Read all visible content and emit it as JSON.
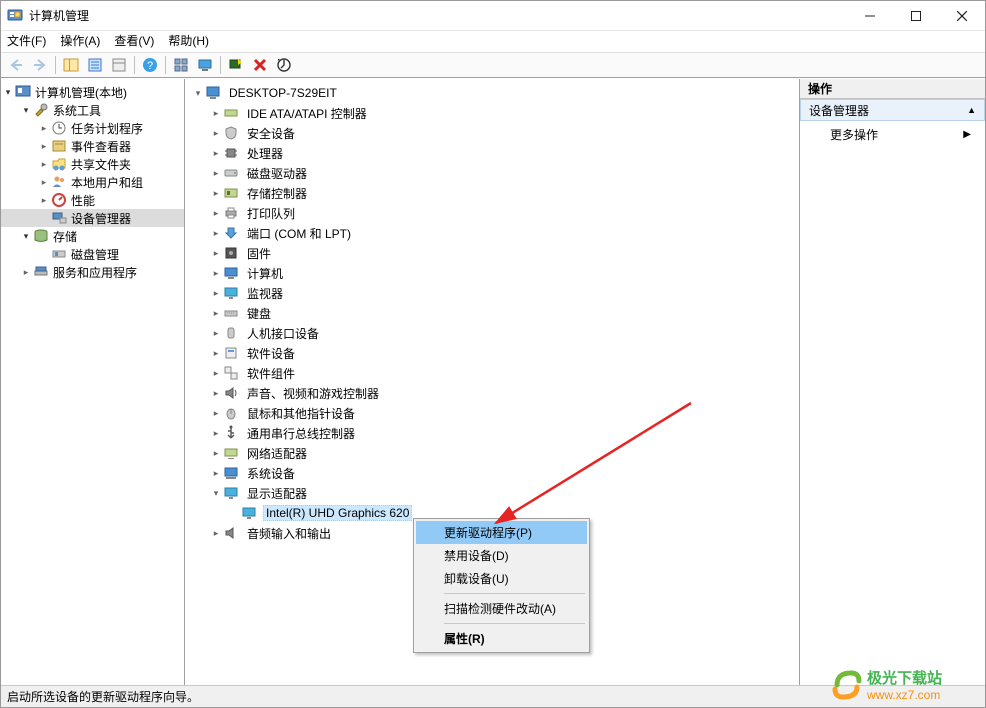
{
  "titlebar": {
    "title": "计算机管理"
  },
  "menus": {
    "file": "文件(F)",
    "action": "操作(A)",
    "view": "查看(V)",
    "help": "帮助(H)"
  },
  "leftTree": {
    "root": "计算机管理(本地)",
    "systemTools": "系统工具",
    "taskScheduler": "任务计划程序",
    "eventViewer": "事件查看器",
    "sharedFolders": "共享文件夹",
    "localUsers": "本地用户和组",
    "performance": "性能",
    "deviceManager": "设备管理器",
    "storage": "存储",
    "diskManagement": "磁盘管理",
    "servicesApps": "服务和应用程序"
  },
  "deviceTree": {
    "computer": "DESKTOP-7S29EIT",
    "ide": "IDE ATA/ATAPI 控制器",
    "security": "安全设备",
    "cpu": "处理器",
    "diskDrives": "磁盘驱动器",
    "storageControllers": "存储控制器",
    "printQueues": "打印队列",
    "ports": "端口 (COM 和 LPT)",
    "firmware": "固件",
    "computers": "计算机",
    "monitors": "监视器",
    "keyboards": "键盘",
    "hid": "人机接口设备",
    "software": "软件设备",
    "softwareComponents": "软件组件",
    "sound": "声音、视频和游戏控制器",
    "mice": "鼠标和其他指针设备",
    "usb": "通用串行总线控制器",
    "network": "网络适配器",
    "system": "系统设备",
    "display": "显示适配器",
    "intelGraphics": "Intel(R) UHD Graphics 620",
    "audio": "音频输入和输出"
  },
  "contextMenu": {
    "updateDriver": "更新驱动程序(P)",
    "disableDevice": "禁用设备(D)",
    "uninstallDevice": "卸载设备(U)",
    "scanHardware": "扫描检测硬件改动(A)",
    "properties": "属性(R)"
  },
  "rightPanel": {
    "header": "操作",
    "section": "设备管理器",
    "moreActions": "更多操作"
  },
  "statusbar": {
    "text": "启动所选设备的更新驱动程序向导。"
  },
  "watermark": {
    "brand": "极光下载站",
    "url": "www.xz7.com"
  }
}
